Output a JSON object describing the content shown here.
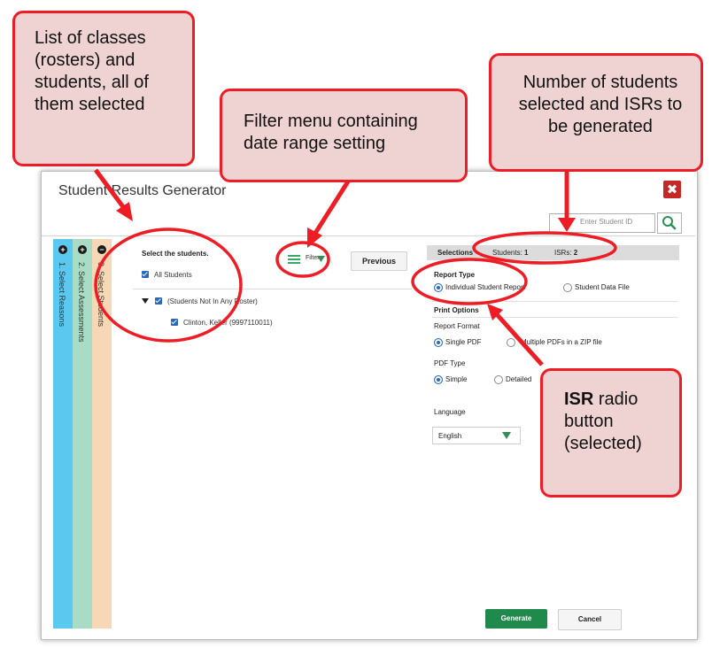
{
  "modal": {
    "title": "Student Results Generator",
    "close_glyph": "✖",
    "search_placeholder": "Enter Student ID"
  },
  "steps": [
    {
      "number": "+",
      "label": "1. Select Reasons"
    },
    {
      "number": "+",
      "label": "2. Select Assessments"
    },
    {
      "number": "−",
      "label": "3. Select Students"
    }
  ],
  "students_panel": {
    "heading": "Select the students.",
    "all_students": "All Students",
    "group": "(Students Not In Any Roster)",
    "student": "Clinton, Keller (9997110011)",
    "filters_label": "Filters",
    "previous_label": "Previous"
  },
  "selections": {
    "heading": "Selections",
    "students_label": "Students: ",
    "students_count": "1",
    "isrs_label": "ISRs: ",
    "isrs_count": "2"
  },
  "report_type": {
    "heading": "Report Type",
    "options": [
      "Individual Student Report",
      "Student Data File"
    ],
    "selected": "Individual Student Report"
  },
  "print_options": {
    "heading": "Print Options",
    "report_format_label": "Report Format",
    "report_format_options": [
      "Single PDF",
      "Multiple PDFs in a ZIP file"
    ],
    "pdf_type_label": "PDF Type",
    "pdf_type_options": [
      "Simple",
      "Detailed"
    ],
    "language_label": "Language",
    "language_value": "English"
  },
  "actions": {
    "generate": "Generate",
    "cancel": "Cancel"
  },
  "callouts": {
    "rosters": "List of classes (rosters) and students, all of them selected",
    "filter": "Filter menu containing date range setting",
    "counts": "Number of students selected and ISRs to be generated",
    "isr_bold": "ISR",
    "isr_rest": " radio button (selected)"
  },
  "colors": {
    "annotation_red": "#ee1c25",
    "callout_fill": "#efd3d3",
    "generate_green": "#1f8a4c",
    "step1": "#5bc8ef",
    "step2": "#a8dcc4",
    "step3": "#f7d8b6",
    "checkbox_blue": "#2a68b8"
  }
}
